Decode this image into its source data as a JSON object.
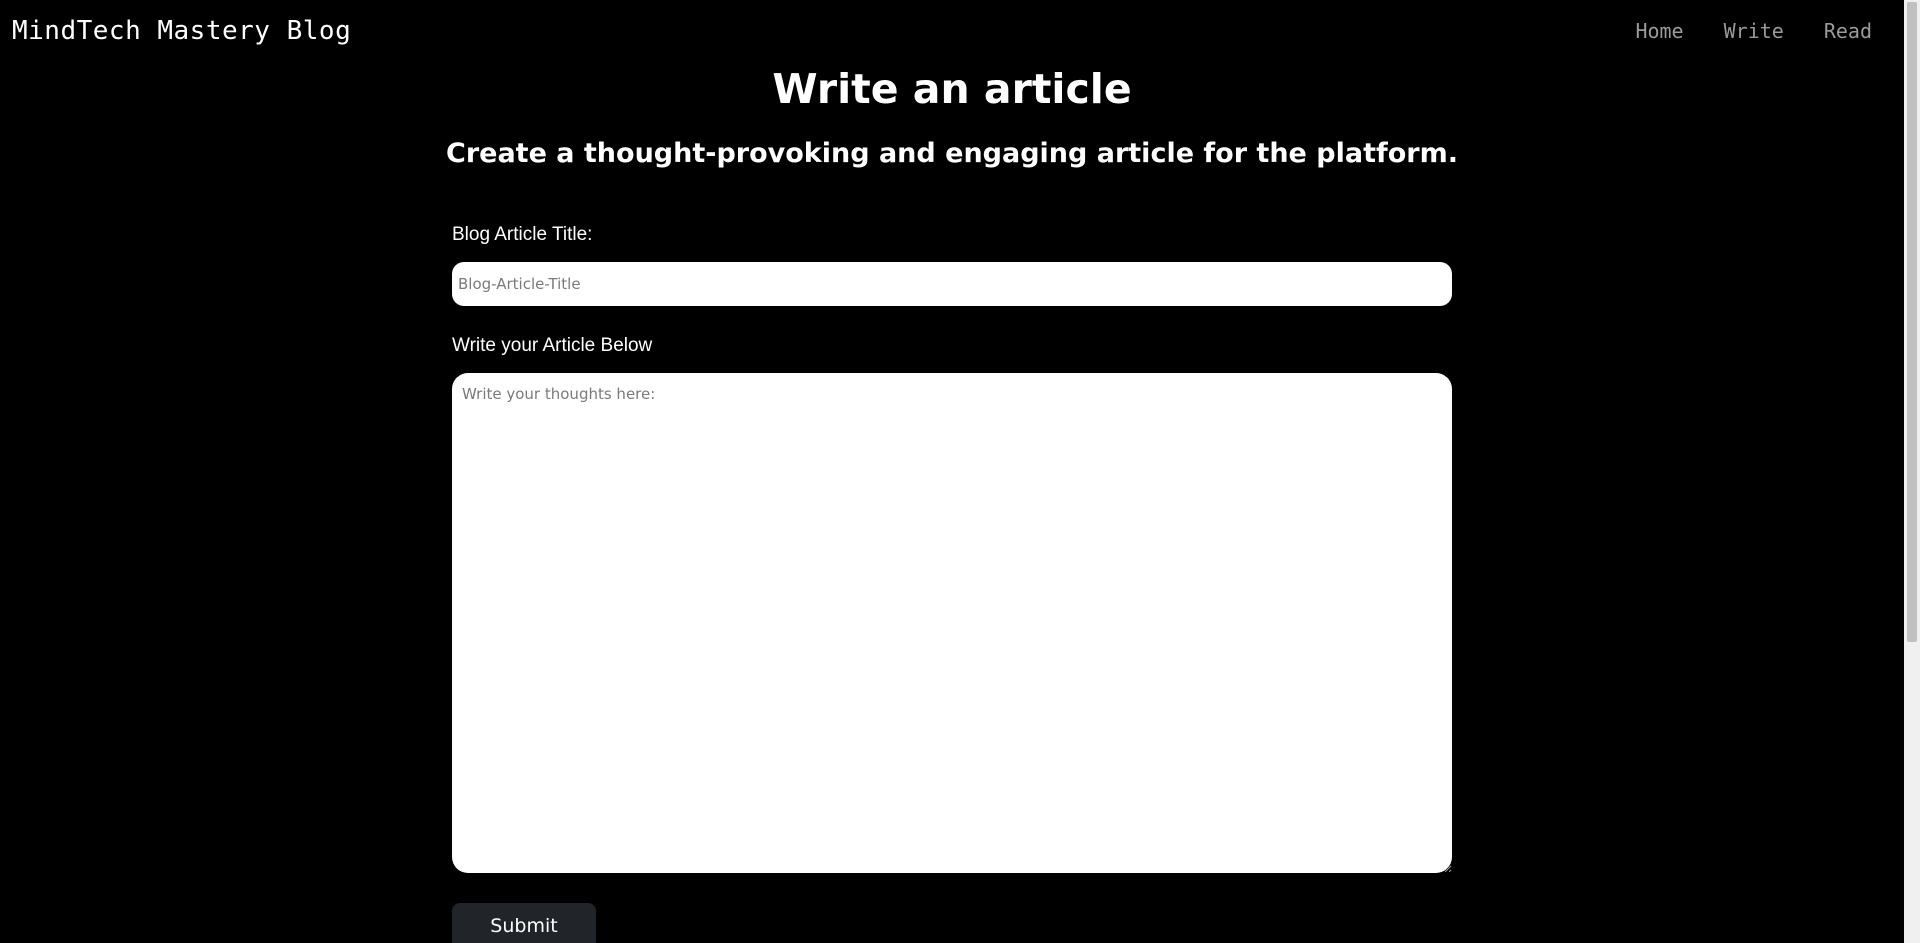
{
  "header": {
    "brand": "MindTech Mastery Blog",
    "nav": [
      {
        "label": "Home"
      },
      {
        "label": "Write"
      },
      {
        "label": "Read"
      }
    ]
  },
  "main": {
    "title": "Write an article",
    "subtitle": "Create a thought-provoking and engaging article for the platform.",
    "form": {
      "title_label": "Blog Article Title:",
      "title_value": "",
      "title_placeholder": "Blog-Article-Title",
      "body_label": "Write your Article Below",
      "body_value": "",
      "body_placeholder": "Write your thoughts here:",
      "submit_label": "Submit"
    }
  },
  "colors": {
    "background": "#000000",
    "text": "#ffffff",
    "nav_text": "#9a9a9a",
    "button_bg": "#212529"
  }
}
